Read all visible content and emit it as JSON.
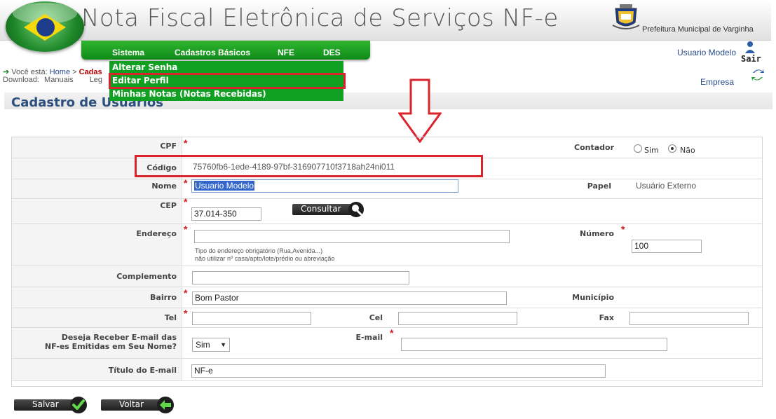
{
  "header": {
    "title": "Nota Fiscal Eletrônica de Serviços NF-e",
    "prefeitura": "Prefeitura Municipal de Varginha"
  },
  "nav": {
    "items": [
      "Sistema",
      "Cadastros Básicos",
      "NFE",
      "DES"
    ]
  },
  "user": {
    "name": "Usuario Modelo",
    "logout": "Sair",
    "empresa": "Empresa"
  },
  "dropdown": {
    "items": [
      "Alterar Senha",
      "Editar Perfil",
      "Minhas Notas (Notas Recebidas)"
    ],
    "selected": "Editar Perfil"
  },
  "breadcrumb": {
    "prefix": "Você está:",
    "home": "Home",
    "separator": ">",
    "current": "Cadas"
  },
  "download": {
    "label": "Download:",
    "manuais": "Manuais",
    "leg": "Leg"
  },
  "page": {
    "title": "Cadastro de Usuarios"
  },
  "form": {
    "cpf_label": "CPF",
    "contador_label": "Contador",
    "contador_sim": "Sim",
    "contador_nao": "Não",
    "contador_value": "Não",
    "codigo_label": "Código",
    "codigo_value": "75760fb6-1ede-4189-97bf-316907710f3718ah24ni011",
    "nome_label": "Nome",
    "nome_value": "Usuario Modelo",
    "papel_label": "Papel",
    "papel_value": "Usuário Externo",
    "cep_label": "CEP",
    "cep_value": "37.014-350",
    "consultar": "Consultar",
    "endereco_label": "Endereço",
    "endereco_value": "",
    "endereco_hint1": "Tipo do endereço obrigatório (Rua,Avenida...)",
    "endereco_hint2": "não utilizar nº casa/apto/lote/prédio ou abreviação",
    "numero_label": "Número",
    "numero_value": "100",
    "complemento_label": "Complemento",
    "complemento_value": "",
    "bairro_label": "Bairro",
    "bairro_value": "Bom Pastor",
    "municipio_label": "Município",
    "tel_label": "Tel",
    "cel_label": "Cel",
    "fax_label": "Fax",
    "receber_label1": "Deseja Receber E-mail das",
    "receber_label2": "NF-es Emitidas em Seu Nome?",
    "receber_value": "Sim",
    "email_label": "E-mail",
    "email_value": "",
    "titulo_label": "Título do E-mail",
    "titulo_value": "NF-e"
  },
  "buttons": {
    "salvar": "Salvar",
    "voltar": "Voltar"
  },
  "colors": {
    "nav_green": "#12a022",
    "highlight_red": "#d9232d",
    "title_blue": "#2b4f7e"
  }
}
